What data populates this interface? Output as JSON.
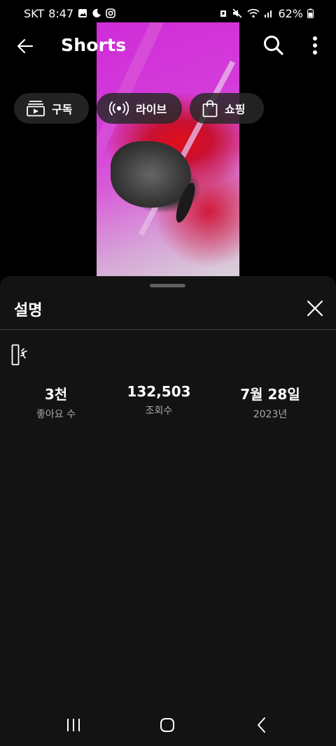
{
  "status_bar": {
    "carrier": "SKT",
    "time": "8:47",
    "battery": "62%"
  },
  "header": {
    "title": "Shorts"
  },
  "chips": [
    {
      "label": "구독",
      "icon": "subscriptions-icon"
    },
    {
      "label": "라이브",
      "icon": "live-icon"
    },
    {
      "label": "쇼핑",
      "icon": "shopping-bag-icon"
    }
  ],
  "sheet": {
    "title": "설명",
    "stats": {
      "likes_value": "3천",
      "likes_label": "좋아요 수",
      "views_value": "132,503",
      "views_label": "조회수",
      "date_value": "7월 28일",
      "date_label": "2023년"
    }
  },
  "colors": {
    "background": "#000000",
    "sheet": "#131313",
    "chip": "#282828",
    "muted_text": "#aaaaaa"
  }
}
